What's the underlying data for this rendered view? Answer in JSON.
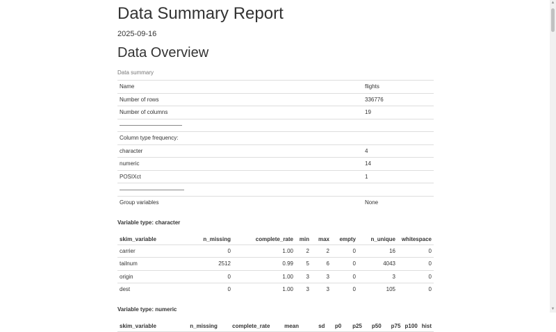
{
  "report": {
    "title": "Data Summary Report",
    "date": "2025-09-16"
  },
  "overview": {
    "heading": "Data Overview",
    "caption": "Data summary",
    "rows": [
      {
        "label": "Name",
        "value": "flights"
      },
      {
        "label": "Number of rows",
        "value": "336776"
      },
      {
        "label": "Number of columns",
        "value": "19"
      }
    ],
    "type_freq_label": "Column type frequency:",
    "type_freq": [
      {
        "label": "character",
        "value": "4"
      },
      {
        "label": "numeric",
        "value": "14"
      },
      {
        "label": "POSIXct",
        "value": "1"
      }
    ],
    "group_label": "Group variables",
    "group_value": "None"
  },
  "character": {
    "heading": "Variable type: character",
    "columns": [
      "skim_variable",
      "n_missing",
      "complete_rate",
      "min",
      "max",
      "empty",
      "n_unique",
      "whitespace"
    ],
    "rows": [
      [
        "carrier",
        "0",
        "1.00",
        "2",
        "2",
        "0",
        "16",
        "0"
      ],
      [
        "tailnum",
        "2512",
        "0.99",
        "5",
        "6",
        "0",
        "4043",
        "0"
      ],
      [
        "origin",
        "0",
        "1.00",
        "3",
        "3",
        "0",
        "3",
        "0"
      ],
      [
        "dest",
        "0",
        "1.00",
        "3",
        "3",
        "0",
        "105",
        "0"
      ]
    ]
  },
  "numeric": {
    "heading": "Variable type: numeric",
    "columns": [
      "skim_variable",
      "n_missing",
      "complete_rate",
      "mean",
      "sd",
      "p0",
      "p25",
      "p50",
      "p75",
      "p100",
      "hist"
    ]
  }
}
